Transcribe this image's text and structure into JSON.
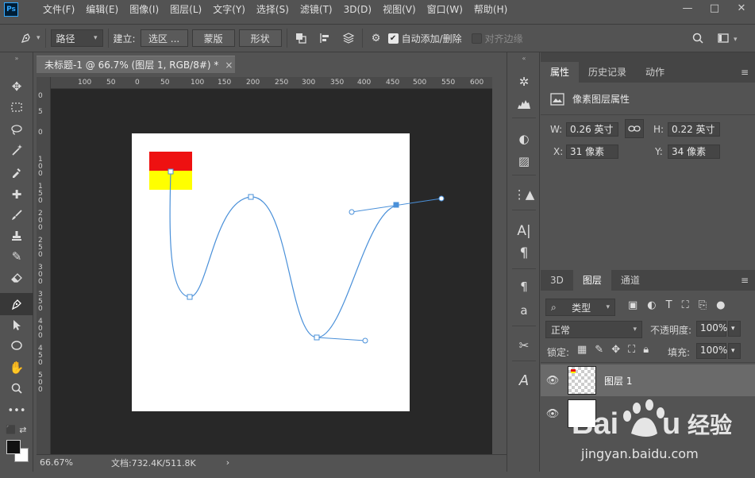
{
  "app": {
    "logo": "Ps"
  },
  "menu": [
    "文件(F)",
    "编辑(E)",
    "图像(I)",
    "图层(L)",
    "文字(Y)",
    "选择(S)",
    "滤镜(T)",
    "3D(D)",
    "视图(V)",
    "窗口(W)",
    "帮助(H)"
  ],
  "window": {
    "minimize": "—",
    "restore": "□",
    "close": "✕"
  },
  "options": {
    "mode": "路径",
    "make_label": "建立:",
    "selection_btn": "选区 ...",
    "mask_btn": "蒙版",
    "shape_btn": "形状",
    "auto_add_label": "自动添加/删除",
    "auto_add_checked": true,
    "align_edges_label": "对齐边缘",
    "align_edges_checked": false
  },
  "document": {
    "tab_title": "未标题-1 @ 66.7% (图层 1, RGB/8#) *",
    "close": "×"
  },
  "ruler": {
    "h_ticks": [
      "100",
      "50",
      "0",
      "50",
      "100",
      "150",
      "200",
      "250",
      "300",
      "350",
      "400",
      "450",
      "500",
      "550",
      "600"
    ],
    "v_ticks": [
      "0",
      "5",
      "0",
      "1 0 0",
      "1 5 0",
      "2 0 0",
      "2 5 0",
      "3 0 0",
      "3 5 0",
      "4 0 0",
      "4 5 0",
      "5 0 0"
    ]
  },
  "status": {
    "zoom": "66.67%",
    "doc_info": "文档:732.4K/511.8K",
    "arrow": "›"
  },
  "properties": {
    "tabs": [
      "属性",
      "历史记录",
      "动作"
    ],
    "header": "像素图层属性",
    "w_label": "W:",
    "w_value": "0.26 英寸",
    "h_label": "H:",
    "h_value": "0.22 英寸",
    "x_label": "X:",
    "x_value": "31 像素",
    "y_label": "Y:",
    "y_value": "34 像素"
  },
  "layers": {
    "tabs": [
      "3D",
      "图层",
      "通道"
    ],
    "filter_kind": "类型",
    "blend_mode": "正常",
    "opacity_label": "不透明度:",
    "opacity_value": "100%",
    "lock_label": "锁定:",
    "fill_label": "填充:",
    "fill_value": "100%",
    "items": [
      {
        "name": "图层 1",
        "selected": true
      },
      {
        "name": "",
        "selected": false
      }
    ]
  },
  "watermark": {
    "brand": "Baidu经验",
    "url": "jingyan.baidu.com"
  },
  "colors": {
    "red": "#ee1111",
    "yellow": "#ffff00",
    "path": "#4a90d9"
  }
}
